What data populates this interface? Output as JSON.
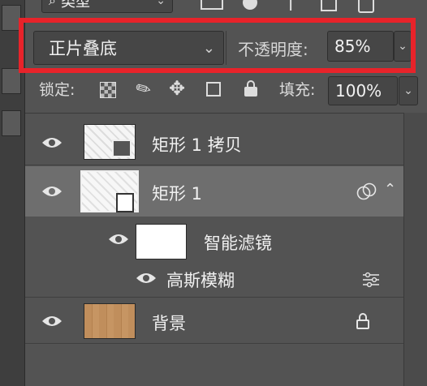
{
  "filter": {
    "kind_label": "类型"
  },
  "blend": {
    "mode": "正片叠底",
    "opacity_label": "不透明度:",
    "opacity_value": "85%"
  },
  "lock": {
    "label": "锁定:",
    "fill_label": "填充:",
    "fill_value": "100%"
  },
  "layers": [
    {
      "name": "矩形 1 拷贝"
    },
    {
      "name": "矩形 1"
    },
    {
      "name": "智能滤镜"
    },
    {
      "name": "高斯模糊"
    },
    {
      "name": "背景"
    }
  ],
  "colors": {
    "highlight": "#e8232a",
    "selected_row": "#6e6e6e",
    "panel": "#535353"
  }
}
